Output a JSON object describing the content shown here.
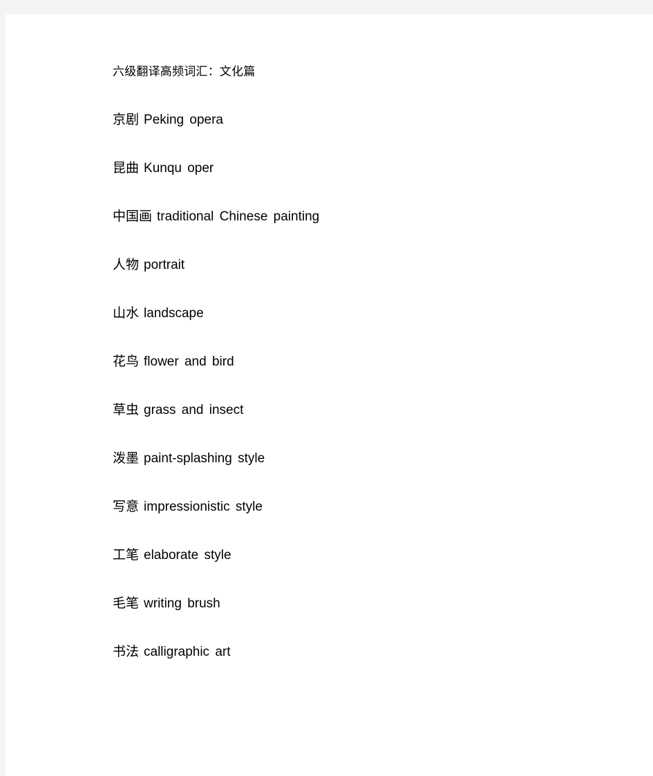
{
  "document": {
    "title": "六级翻译高频词汇：文化篇",
    "entries": [
      {
        "chinese": "京剧",
        "english": "Peking opera"
      },
      {
        "chinese": "昆曲",
        "english": "Kunqu oper"
      },
      {
        "chinese": "中国画",
        "english": "traditional Chinese painting"
      },
      {
        "chinese": "人物",
        "english": "portrait"
      },
      {
        "chinese": "山水",
        "english": "landscape"
      },
      {
        "chinese": "花鸟",
        "english": "flower and bird"
      },
      {
        "chinese": "草虫",
        "english": "grass and insect"
      },
      {
        "chinese": "泼墨",
        "english": "paint-splashing style"
      },
      {
        "chinese": "写意",
        "english": "impressionistic style"
      },
      {
        "chinese": "工笔",
        "english": "elaborate style"
      },
      {
        "chinese": "毛笔",
        "english": "writing brush"
      },
      {
        "chinese": "书法",
        "english": "calligraphic art"
      }
    ]
  },
  "theme": {
    "page_background": "#ffffff",
    "canvas_background": "#f4f4f4",
    "text_color": "#000000"
  }
}
